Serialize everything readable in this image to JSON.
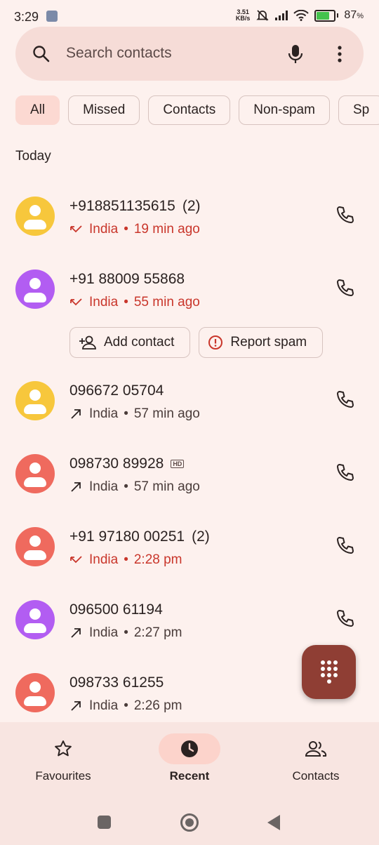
{
  "status_bar": {
    "time": "3:29",
    "speed_value": "3.51",
    "speed_unit": "KB/s",
    "battery": "87",
    "battery_unit": "%"
  },
  "search": {
    "placeholder": "Search contacts"
  },
  "filters": [
    "All",
    "Missed",
    "Contacts",
    "Non-spam",
    "Sp"
  ],
  "section_title": "Today",
  "calls": [
    {
      "number": "+918851135615",
      "count": "(2)",
      "type": "missed",
      "location": "India",
      "time": "19 min ago",
      "avatar_color": "#f7c73c"
    },
    {
      "number": "+91 88009 55868",
      "count": "",
      "type": "missed",
      "location": "India",
      "time": "55 min ago",
      "avatar_color": "#b25df2"
    },
    {
      "number": "096672 05704",
      "count": "",
      "type": "outgoing",
      "location": "India",
      "time": "57 min ago",
      "avatar_color": "#f7c73c"
    },
    {
      "number": "098730 89928",
      "count": "",
      "type": "outgoing",
      "location": "India",
      "time": "57 min ago",
      "avatar_color": "#ef6a5e",
      "hd": "HD"
    },
    {
      "number": "+91 97180 00251",
      "count": "(2)",
      "type": "missed",
      "location": "India",
      "time": "2:28 pm",
      "avatar_color": "#ef6a5e"
    },
    {
      "number": "096500 61194",
      "count": "",
      "type": "outgoing",
      "location": "India",
      "time": "2:27 pm",
      "avatar_color": "#b25df2"
    },
    {
      "number": "098733 61255",
      "count": "",
      "type": "outgoing",
      "location": "India",
      "time": "2:26 pm",
      "avatar_color": "#ef6a5e"
    }
  ],
  "separator": "•",
  "actions": {
    "add_contact": "Add contact",
    "report_spam": "Report spam"
  },
  "bottom_nav": {
    "favourites": "Favourites",
    "recent": "Recent",
    "contacts": "Contacts"
  }
}
